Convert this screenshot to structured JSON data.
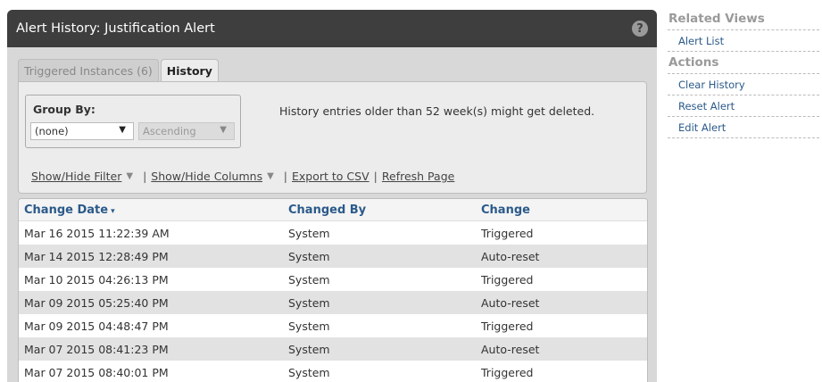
{
  "panel": {
    "title": "Alert History: Justification Alert",
    "help_icon": "?"
  },
  "tabs": [
    {
      "label": "Triggered Instances (6)",
      "active": false
    },
    {
      "label": "History",
      "active": true
    }
  ],
  "group_by": {
    "label": "Group By:",
    "field_value": "(none)",
    "order_value": "Ascending"
  },
  "history_note": "History entries older than 52 week(s) might get deleted.",
  "links": {
    "show_hide_filter": "Show/Hide Filter",
    "show_hide_columns": "Show/Hide Columns",
    "export_csv": "Export to CSV",
    "refresh_page": "Refresh Page",
    "separator": "|"
  },
  "table": {
    "columns": [
      "Change Date",
      "Changed By",
      "Change"
    ],
    "sort_indicator": "▾",
    "rows": [
      [
        "Mar 16 2015 11:22:39 AM",
        "System",
        "Triggered"
      ],
      [
        "Mar 14 2015 12:28:49 PM",
        "System",
        "Auto-reset"
      ],
      [
        "Mar 10 2015 04:26:13 PM",
        "System",
        "Triggered"
      ],
      [
        "Mar 09 2015 05:25:40 PM",
        "System",
        "Auto-reset"
      ],
      [
        "Mar 09 2015 04:48:47 PM",
        "System",
        "Triggered"
      ],
      [
        "Mar 07 2015 08:41:23 PM",
        "System",
        "Auto-reset"
      ],
      [
        "Mar 07 2015 08:40:01 PM",
        "System",
        "Triggered"
      ]
    ]
  },
  "sidebar": {
    "related_views_heading": "Related Views",
    "related_views": [
      "Alert List"
    ],
    "actions_heading": "Actions",
    "actions": [
      "Clear History",
      "Reset Alert",
      "Edit Alert"
    ]
  },
  "colors": {
    "header_bg": "#3e3e3e",
    "panel_bg": "#d8d8d8",
    "link_blue": "#2b5a8a",
    "row_alt": "#e2e2e2"
  }
}
